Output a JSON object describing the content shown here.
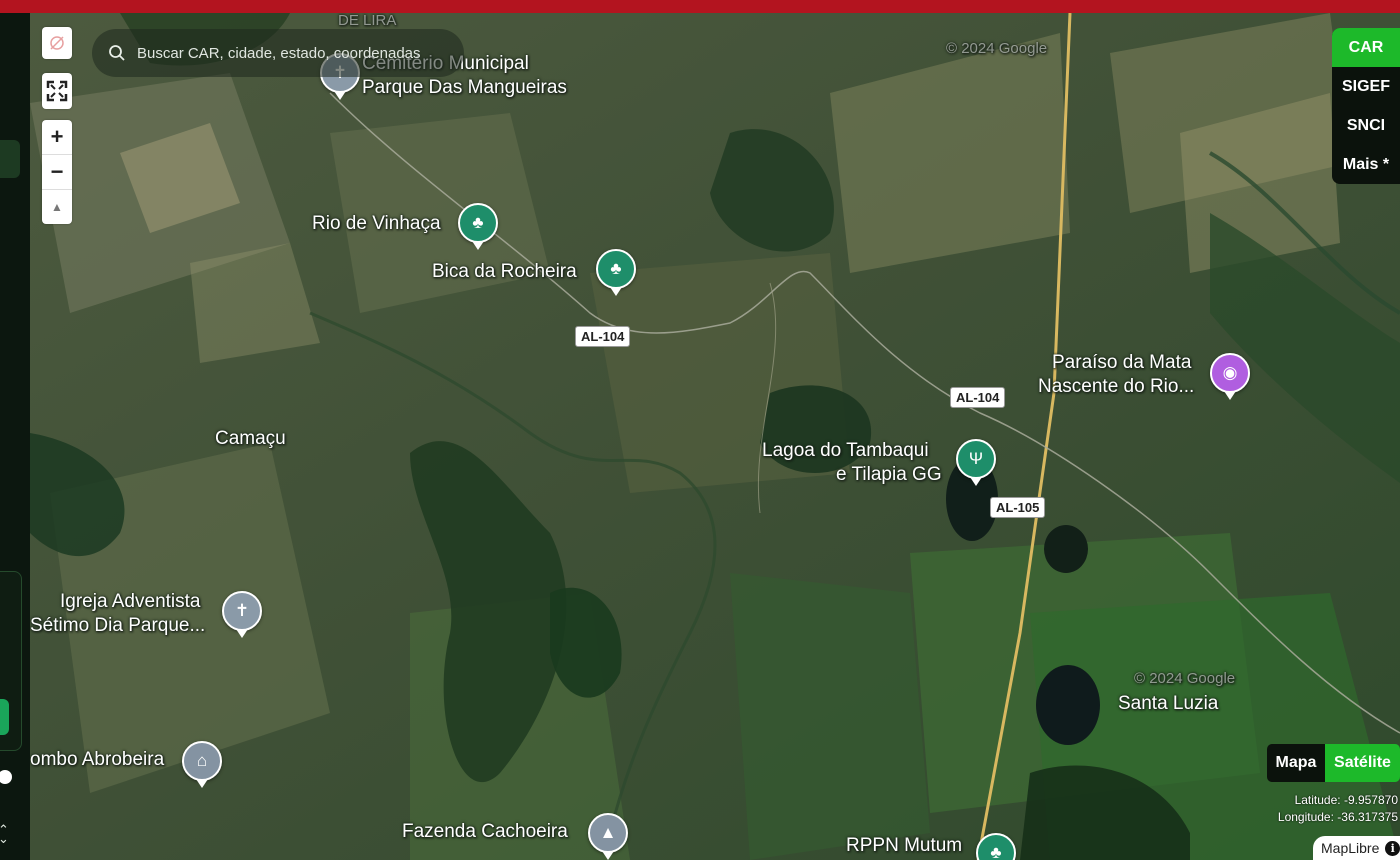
{
  "search": {
    "placeholder": "Buscar CAR, cidade, estado, coordenadas"
  },
  "map_controls": {
    "zoom_in": "+",
    "zoom_out": "−",
    "compass": "▲"
  },
  "layer_menu": [
    {
      "label": "CAR",
      "active": true
    },
    {
      "label": "SIGEF",
      "active": false
    },
    {
      "label": "SNCI",
      "active": false
    },
    {
      "label": "Mais *",
      "active": false
    }
  ],
  "basemap": {
    "map_label": "Mapa",
    "satellite_label": "Satélite",
    "active": "Satélite"
  },
  "coordinates": {
    "latitude": "Latitude: -9.957870",
    "longitude": "Longitude: -36.317375"
  },
  "attribution": {
    "text": "MapLibre",
    "info": "i"
  },
  "map_labels": {
    "top_cut": "DE LIRA",
    "cemetery_line1": "Cemitério Municipal",
    "cemetery_line2": "Parque Das Mangueiras",
    "rio_vinhaca": "Rio de Vinhaça",
    "bica_rocheira": "Bica da Rocheira",
    "camacu": "Camaçu",
    "lagoa_line1": "Lagoa do Tambaqui",
    "lagoa_line2": "e Tilapia GG",
    "paraiso_line1": "Paraíso da Mata",
    "paraiso_line2": "Nascente do Rio...",
    "igreja_line1": "Igreja Adventista",
    "igreja_line2": "Sétimo Dia Parque...",
    "quilombo": "ombo Abrobeira",
    "fazenda": "Fazenda Cachoeira",
    "santa_luzia": "Santa Luzia",
    "rppn": "RPPN Mutum",
    "watermark": "© 2024 Google"
  },
  "road_shields": {
    "al104_a": "AL-104",
    "al104_b": "AL-104",
    "al105": "AL-105"
  },
  "colors": {
    "topbar": "#b3141f",
    "accent_green": "#1db92a",
    "panel_dark": "#0b120c"
  },
  "icons": {
    "cemetery": "cemetery-pin-icon",
    "park": "tree-pin-icon",
    "church": "cross-pin-icon",
    "school": "graduation-cap-pin-icon",
    "tourism": "camera-pin-icon",
    "restaurant": "fork-knife-pin-icon",
    "settlement": "settlement-pin-icon"
  }
}
